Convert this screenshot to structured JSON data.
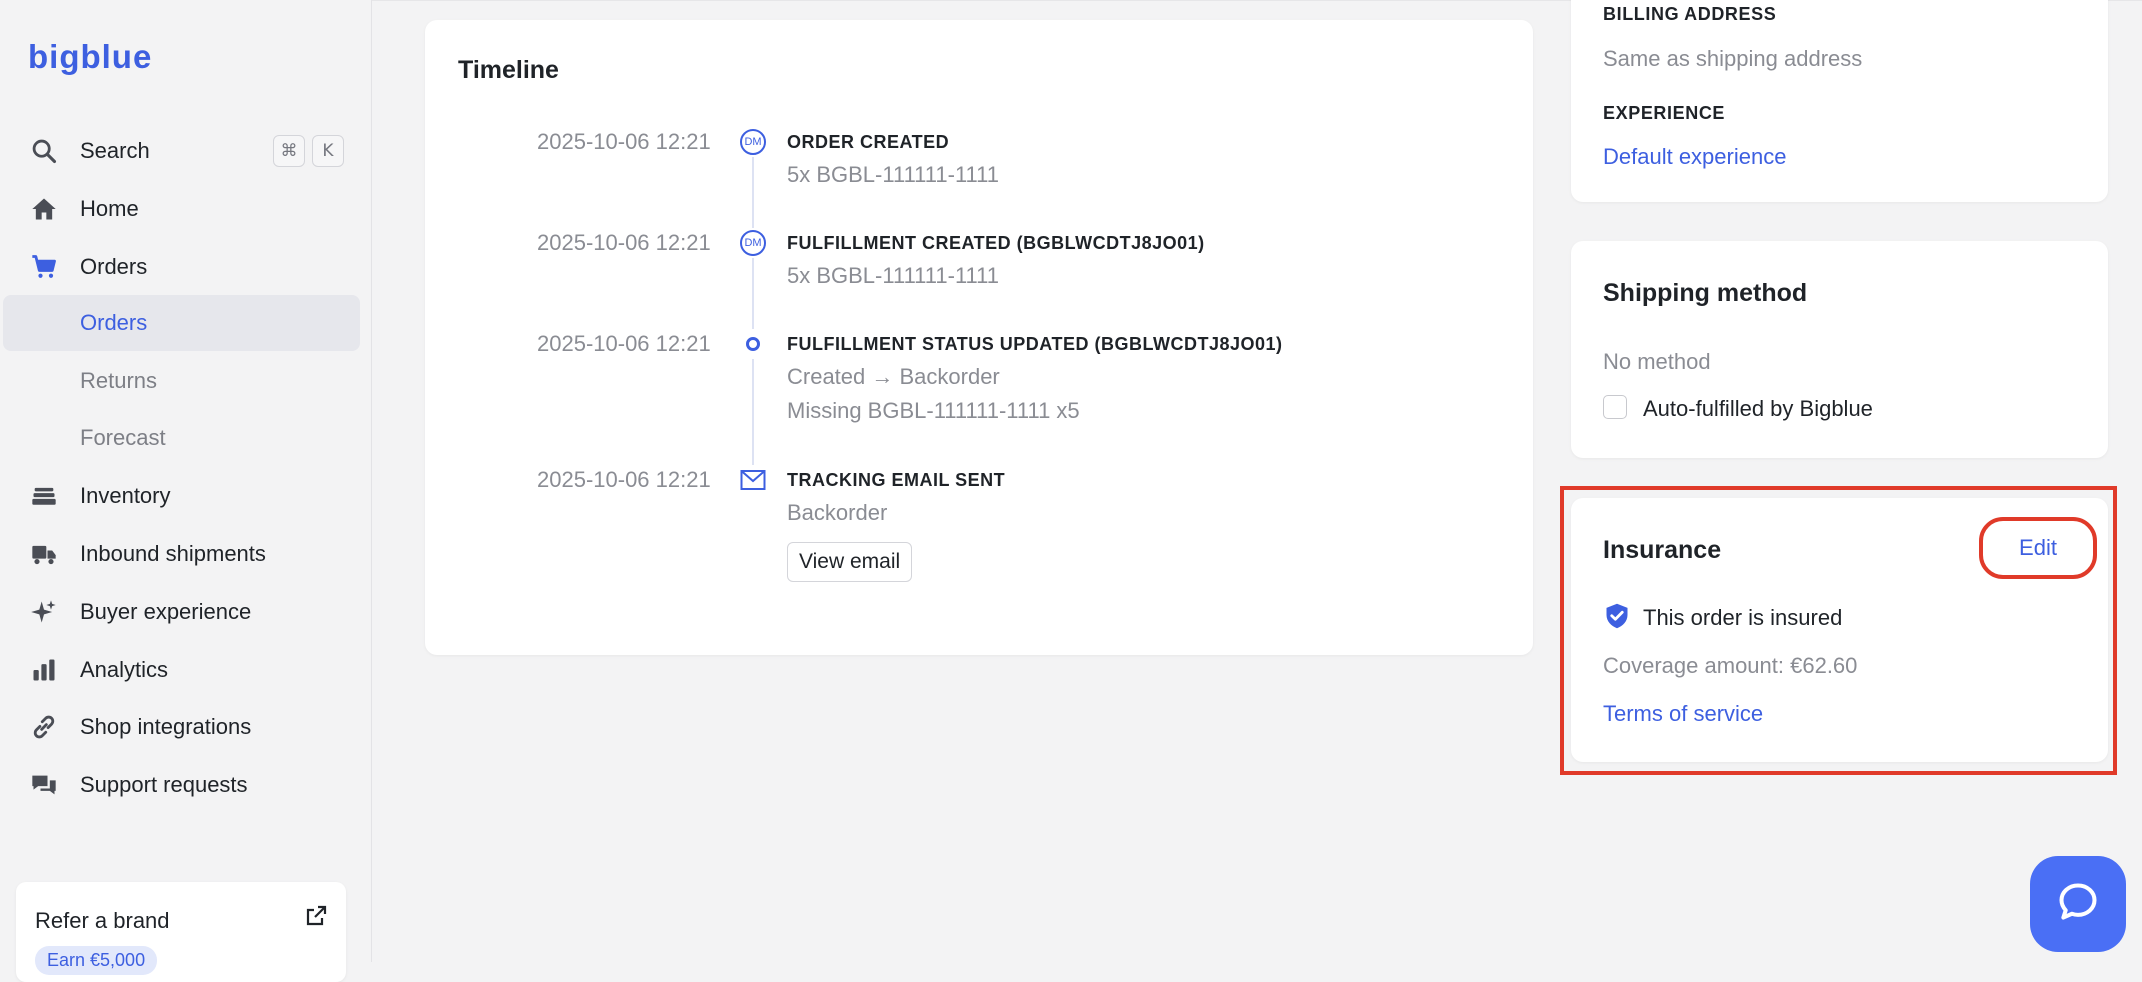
{
  "brand": {
    "logo_text": "bigblue",
    "accent": "#3d5fe0",
    "highlight_color": "#e03a29"
  },
  "sidebar": {
    "search": {
      "label": "Search",
      "shortcut_cmd": "⌘",
      "shortcut_key": "K"
    },
    "items": [
      {
        "label": "Home",
        "icon": "home-icon"
      },
      {
        "label": "Orders",
        "icon": "cart-icon"
      },
      {
        "label": "Orders",
        "sub": true,
        "active": true
      },
      {
        "label": "Returns",
        "sub": true
      },
      {
        "label": "Forecast",
        "sub": true
      },
      {
        "label": "Inventory",
        "icon": "inventory-icon"
      },
      {
        "label": "Inbound shipments",
        "icon": "truck-icon"
      },
      {
        "label": "Buyer experience",
        "icon": "sparkle-icon"
      },
      {
        "label": "Analytics",
        "icon": "bar-chart-icon"
      },
      {
        "label": "Shop integrations",
        "icon": "link-icon"
      },
      {
        "label": "Support requests",
        "icon": "chat-bubbles-icon"
      }
    ],
    "refer": {
      "title": "Refer a brand",
      "badge": "Earn €5,000"
    }
  },
  "timeline": {
    "title": "Timeline",
    "entries": [
      {
        "date": "2025-10-06 12:21",
        "marker": "DM",
        "heading": "ORDER CREATED",
        "lines": [
          "5x BGBL-111111-1111"
        ]
      },
      {
        "date": "2025-10-06 12:21",
        "marker": "DM",
        "heading": "FULFILLMENT CREATED (BGBLWCDTJ8JO01)",
        "lines": [
          "5x BGBL-111111-1111"
        ]
      },
      {
        "date": "2025-10-06 12:21",
        "marker": "dot",
        "heading": "FULFILLMENT STATUS UPDATED (BGBLWCDTJ8JO01)",
        "lines": [
          "Created → Backorder",
          "Missing BGBL-111111-1111 x5"
        ]
      },
      {
        "date": "2025-10-06 12:21",
        "marker": "mail",
        "heading": "TRACKING EMAIL SENT",
        "lines": [
          "Backorder"
        ],
        "button": "View email"
      }
    ]
  },
  "billing": {
    "billing_label": "BILLING ADDRESS",
    "billing_value": "Same as shipping address",
    "experience_label": "EXPERIENCE",
    "experience_value": "Default experience"
  },
  "shipping": {
    "title": "Shipping method",
    "method": "No method",
    "auto_fulfilled_label": "Auto-fulfilled by Bigblue",
    "auto_fulfilled_checked": false
  },
  "insurance": {
    "title": "Insurance",
    "edit_label": "Edit",
    "status": "This order is insured",
    "coverage": "Coverage amount: €62.60",
    "terms": "Terms of service"
  }
}
